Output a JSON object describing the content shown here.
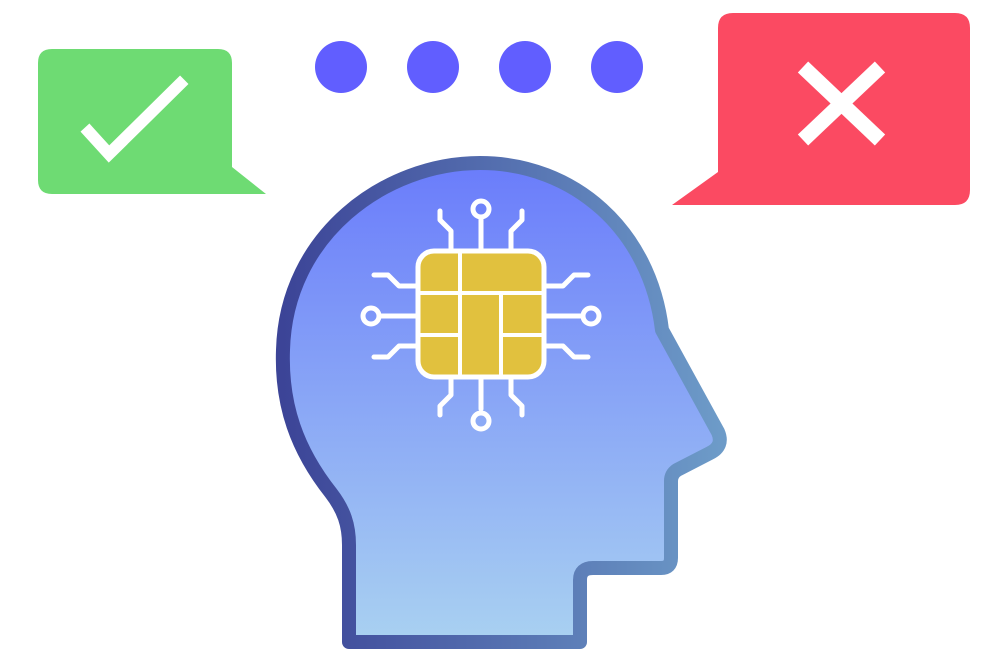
{
  "illustration": {
    "icons": {
      "approve": "check-icon",
      "reject": "cross-icon",
      "thinking": "ellipsis-dots",
      "head": "human-head-profile",
      "brain": "microchip-icon"
    },
    "dot_count": 4,
    "colors": {
      "approve_bubble": "#6EDB73",
      "reject_bubble": "#FB4A62",
      "dots": "#615EFF",
      "head_fill_top": "#6A7CFB",
      "head_fill_bottom": "#A9D1F1",
      "head_outline_left": "#3C4497",
      "head_outline_right": "#6D9BC8",
      "chip_fill": "#E1C13E",
      "circuit_lines": "#FFFFFF",
      "background": "#FFFFFF"
    }
  }
}
